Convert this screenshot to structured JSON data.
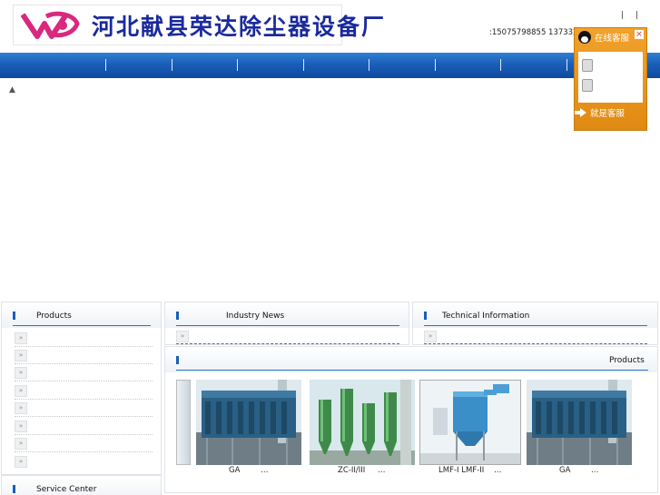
{
  "header": {
    "logo_text": "河北献县荣达除尘器设备厂",
    "top_links": [
      "|",
      "|"
    ],
    "phone": ":15075798855 13733276"
  },
  "nav": {
    "items": [
      "",
      "",
      "",
      "",
      "",
      "",
      "",
      "",
      ""
    ]
  },
  "misc": {
    "up_arrow": "▲"
  },
  "qq_widget": {
    "title": "在线客服",
    "close": "×",
    "footer": "就是客服"
  },
  "sidebar": {
    "products_title": "Products",
    "product_items": [
      "",
      "",
      "",
      "",
      "",
      "",
      "",
      ""
    ],
    "bullet_glyph": "»",
    "service_title": "Service Center"
  },
  "industry_news": {
    "title": "Industry News",
    "items": [
      ""
    ]
  },
  "technical_info": {
    "title": "Technical Information",
    "items": [
      ""
    ]
  },
  "products_gallery": {
    "title": "Products",
    "items": [
      {
        "caption_left": "GA",
        "caption_right": "…"
      },
      {
        "caption_left": "ZC-II/III",
        "caption_right": "…"
      },
      {
        "caption_left": "LMF-I LMF-II",
        "caption_right": "…"
      },
      {
        "caption_left": "GA",
        "caption_right": "…"
      }
    ]
  },
  "colors": {
    "nav_blue": "#1a5eb8",
    "logo_blue": "#1a2a9c",
    "logo_pink": "#d9287f",
    "qq_orange": "#f1a22c"
  }
}
